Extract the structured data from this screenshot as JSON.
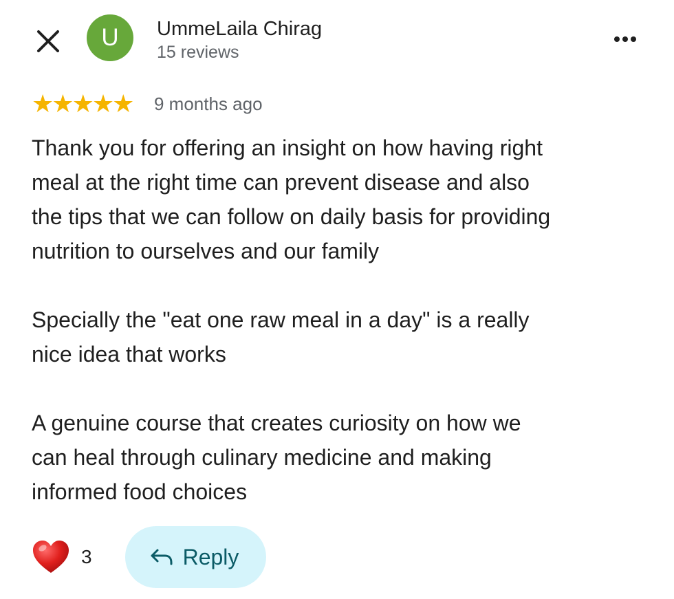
{
  "header": {
    "close_icon": "close-icon",
    "avatar_letter": "U",
    "avatar_color": "#67a83a",
    "user_name": "UmmeLaila Chirag",
    "review_count": "15 reviews",
    "more_icon": "more-options-icon"
  },
  "rating": {
    "stars": 5,
    "max_stars": 5,
    "star_color": "#f5b400",
    "star_glyph": "★",
    "time_ago": "9 months ago"
  },
  "review": {
    "paragraphs": [
      "Thank you for offering an insight on how having right\nmeal at the right time can prevent disease and also\nthe tips that we can follow on daily basis for providing\nnutrition to ourselves and our family",
      "Specially the \"eat one raw meal in a day\" is a really\nnice idea that works",
      "A genuine course that creates curiosity on how we\ncan heal through culinary medicine and making\ninformed food choices"
    ]
  },
  "actions": {
    "like_icon": "heart-icon",
    "like_color": "#e0201d",
    "like_count": "3",
    "reply_icon": "reply-arrow-icon",
    "reply_label": "Reply",
    "reply_bg_color": "#d5f4fb",
    "reply_text_color": "#0b5b66"
  }
}
